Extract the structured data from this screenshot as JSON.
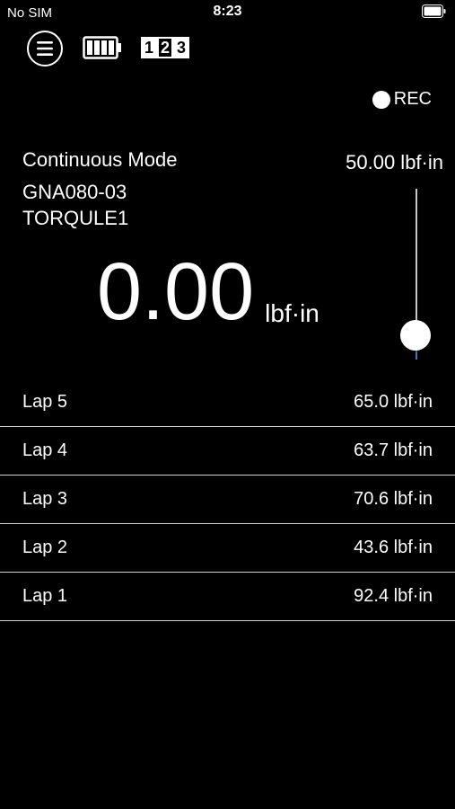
{
  "status_bar": {
    "carrier": "No SIM",
    "time": "8:23"
  },
  "toolbar": {
    "menu_icon": "hamburger-menu-icon",
    "battery_icon": "battery-full-icon",
    "counter_digits": [
      "1",
      "2",
      "3"
    ]
  },
  "rec": {
    "label": "REC"
  },
  "mode": "Continuous Mode",
  "device": {
    "model": "GNA080-03",
    "name": "TORQULE1"
  },
  "max_value": "50.00 lbf·in",
  "reading": {
    "value": "0.00",
    "unit": "lbf·in"
  },
  "slider": {
    "accent": "#3a7bd5"
  },
  "laps": [
    {
      "label": "Lap 5",
      "value": "65.0 lbf·in"
    },
    {
      "label": "Lap 4",
      "value": "63.7 lbf·in"
    },
    {
      "label": "Lap 3",
      "value": "70.6 lbf·in"
    },
    {
      "label": "Lap 2",
      "value": "43.6 lbf·in"
    },
    {
      "label": "Lap 1",
      "value": "92.4 lbf·in"
    }
  ]
}
